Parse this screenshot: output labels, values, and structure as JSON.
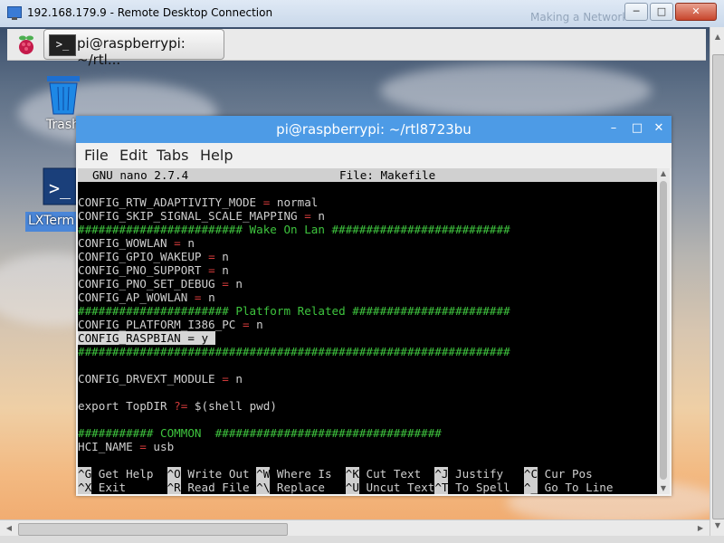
{
  "rdc": {
    "title": "192.168.179.9 - Remote Desktop Connection",
    "ghost_title": "Making a Network",
    "minimize": "─",
    "maximize": "□",
    "close": "✕"
  },
  "taskbar": {
    "task_label": "pi@raspberrypi: ~/rtl..."
  },
  "desktop": {
    "trash_label": "Trash",
    "lxterminal_label": "LXTerm"
  },
  "terminal": {
    "title": "pi@raspberrypi: ~/rtl8723bu",
    "minimize": "–",
    "maximize": "□",
    "close": "✕",
    "menus": [
      "File",
      "Edit",
      "Tabs",
      "Help"
    ]
  },
  "nano": {
    "version": "GNU nano 2.7.4",
    "file_label": "File: Makefile",
    "lines": {
      "l1_key": "CONFIG_RTW_ADAPTIVITY_MODE",
      "l1_val": " normal",
      "l2_key": "CONFIG_SKIP_SIGNAL_SCALE_MAPPING",
      "l2_val": " n",
      "l3": "######################## Wake On Lan ##########################",
      "l4_key": "CONFIG_WOWLAN",
      "l4_val": " n",
      "l5_key": "CONFIG_GPIO_WAKEUP",
      "l5_val": " n",
      "l6_key": "CONFIG_PNO_SUPPORT",
      "l6_val": " n",
      "l7_key": "CONFIG_PNO_SET_DEBUG",
      "l7_val": " n",
      "l8_key": "CONFIG_AP_WOWLAN",
      "l8_val": " n",
      "l9": "###################### Platform Related #######################",
      "l10_key": "CONFIG_PLATFORM_I386_PC",
      "l10_val": " n",
      "l11": "CONFIG_RASPBIAN = y ",
      "l12": "###############################################################",
      "l13_key": "CONFIG_DRVEXT_MODULE",
      "l13_val": " n",
      "l14a": "export TopDIR ",
      "l14b": "?=",
      "l14c": " $(shell pwd)",
      "l15a": "########### COMMON  ",
      "l15b": "#################################",
      "l16_key": "HCI_NAME",
      "l16_val": " usb",
      "eq": " =",
      "eq_plain": " ="
    },
    "shortcuts_row1": [
      {
        "key": "^G",
        "label": " Get Help  "
      },
      {
        "key": "^O",
        "label": " Write Out "
      },
      {
        "key": "^W",
        "label": " Where Is  "
      },
      {
        "key": "^K",
        "label": " Cut Text  "
      },
      {
        "key": "^J",
        "label": " Justify   "
      },
      {
        "key": "^C",
        "label": " Cur Pos"
      }
    ],
    "shortcuts_row2": [
      {
        "key": "^X",
        "label": " Exit      "
      },
      {
        "key": "^R",
        "label": " Read File "
      },
      {
        "key": "^\\",
        "label": " Replace   "
      },
      {
        "key": "^U",
        "label": " Uncut Text"
      },
      {
        "key": "^T",
        "label": " To Spell  "
      },
      {
        "key": "^_",
        "label": " Go To Line"
      }
    ]
  }
}
